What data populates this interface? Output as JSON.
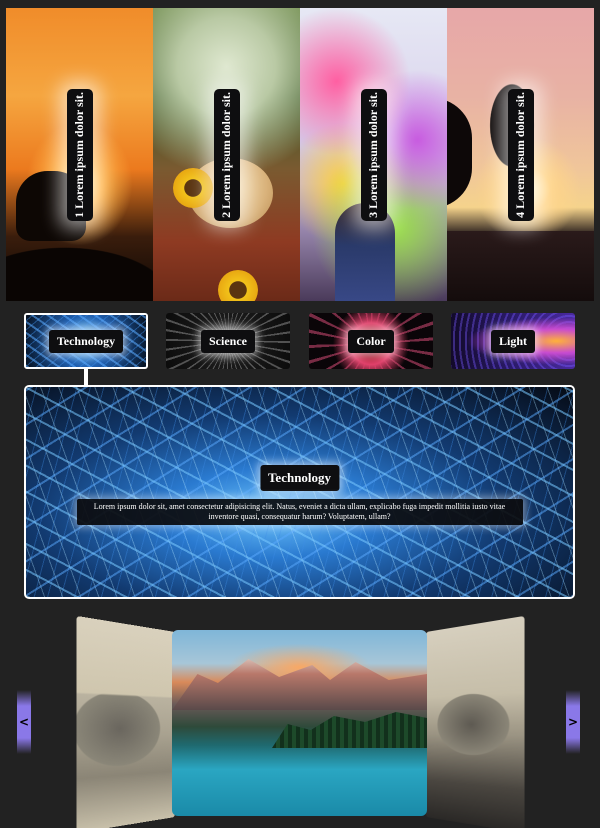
{
  "gallery": {
    "panels": [
      {
        "label": "1 Lorem ipsum dolor sit."
      },
      {
        "label": "2 Lorem ipsum dolor sit."
      },
      {
        "label": "3 Lorem ipsum dolor sit."
      },
      {
        "label": "4 Lorem ipsum dolor sit."
      }
    ]
  },
  "tabs": [
    {
      "label": "Technology",
      "active": true
    },
    {
      "label": "Science",
      "active": false
    },
    {
      "label": "Color",
      "active": false
    },
    {
      "label": "Light",
      "active": false
    }
  ],
  "feature": {
    "title": "Technology",
    "description": "Lorem ipsum dolor sit, amet consectetur adipisicing elit. Natus, eveniet a dicta ullam, explicabo fuga impedit mollitia iusto vitae inventore quasi, consequatur harum? Voluptatem, ullam?"
  },
  "carousel": {
    "prev_label": "<",
    "next_label": ">"
  },
  "colors": {
    "page_background": "#222222",
    "nav_button": "#8a78e8",
    "label_background": "#0e0e10"
  }
}
